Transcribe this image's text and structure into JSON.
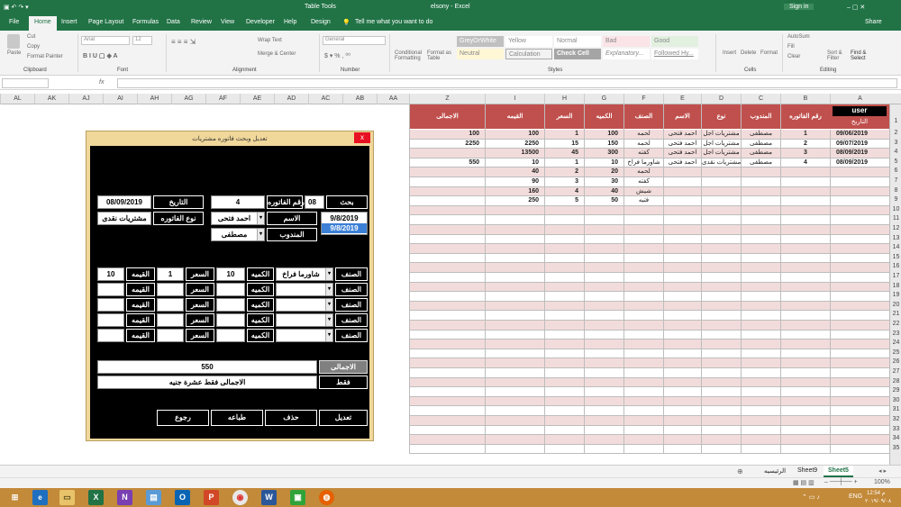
{
  "window": {
    "left_title": "Table Tools",
    "title": "elsony - Excel",
    "sign_in": "Sign in",
    "controls": "–  ▢  ✕"
  },
  "menu": {
    "tabs": [
      "File",
      "Home",
      "Insert",
      "Page Layout",
      "Formulas",
      "Data",
      "Review",
      "View",
      "Developer",
      "Help",
      "Design"
    ],
    "tell": "Tell me what you want to do",
    "share": "Share"
  },
  "ribbon": {
    "paste": "Paste",
    "cut": "Cut",
    "copy": "Copy",
    "format_painter": "Format Painter",
    "clipboard": "Clipboard",
    "font_name": "Arial",
    "font_size": "12",
    "font": "Font",
    "wrap_text": "Wrap Text",
    "merge": "Merge & Center",
    "alignment": "Alignment",
    "number_format": "General",
    "number": "Number",
    "cond_fmt": "Conditional Formatting",
    "format_as_table": "Format as Table",
    "styles": [
      "GreyOrWhite",
      "Yellow",
      "Normal",
      "Bad",
      "Good",
      "Neutral",
      "Calculation",
      "Check Cell",
      "Explanatory...",
      "Followed Hy..."
    ],
    "styles_label": "Styles",
    "insert": "Insert",
    "delete": "Delete",
    "format": "Format",
    "cells": "Cells",
    "autosum": "AutoSum",
    "fill": "Fill",
    "clear": "Clear",
    "sort": "Sort & Filter",
    "find": "Find & Select",
    "editing": "Editing"
  },
  "formula": {
    "name_box": "",
    "fx": "fx",
    "value": ""
  },
  "columns_left": [
    "AL",
    "AK",
    "AJ",
    "AI",
    "AH",
    "AG",
    "AF",
    "AE",
    "AD",
    "AC",
    "AB",
    "AA"
  ],
  "columns_right": [
    "Z",
    "I",
    "H",
    "G",
    "F",
    "E",
    "D",
    "C",
    "B",
    "A"
  ],
  "header_row": {
    "A": "التاريخ",
    "A_top": "user",
    "B": "رقم الفاتوره",
    "C": "المندوب",
    "D": "نوع",
    "E": "الاسم",
    "F": "الصنف",
    "G": "الكميه",
    "H": "السعر",
    "I": "القيمه",
    "Z": "الاجمالى"
  },
  "rows": [
    {
      "n": "2",
      "A": "09/06/2019",
      "B": "1",
      "C": "مصطفى",
      "D": "مشتريات اجل",
      "E": "احمد فتحى",
      "F": "لحمه",
      "G": "100",
      "H": "1",
      "I": "100",
      "Z": "100"
    },
    {
      "n": "3",
      "A": "09/07/2019",
      "B": "2",
      "C": "مصطفى",
      "D": "مشتريات اجل",
      "E": "احمد فتحى",
      "F": "لحمه",
      "G": "150",
      "H": "15",
      "I": "2250",
      "Z": "2250"
    },
    {
      "n": "4",
      "A": "08/09/2019",
      "B": "3",
      "C": "مصطفى",
      "D": "مشتريات اجل",
      "E": "احمد فتحى",
      "F": "كفته",
      "G": "300",
      "H": "45",
      "I": "13500",
      "Z": ""
    },
    {
      "n": "5",
      "A": "08/09/2019",
      "B": "4",
      "C": "مصطفى",
      "D": "مشتريات نقدى",
      "E": "احمد فتحى",
      "F": "شاورما فراخ",
      "G": "10",
      "H": "1",
      "I": "10",
      "Z": "550"
    },
    {
      "n": "6",
      "A": "",
      "B": "",
      "C": "",
      "D": "",
      "E": "",
      "F": "لحمه",
      "G": "20",
      "H": "2",
      "I": "40",
      "Z": ""
    },
    {
      "n": "7",
      "A": "",
      "B": "",
      "C": "",
      "D": "",
      "E": "",
      "F": "كفته",
      "G": "30",
      "H": "3",
      "I": "90",
      "Z": ""
    },
    {
      "n": "8",
      "A": "",
      "B": "",
      "C": "",
      "D": "",
      "E": "",
      "F": "شيش",
      "G": "40",
      "H": "4",
      "I": "160",
      "Z": ""
    },
    {
      "n": "9",
      "A": "",
      "B": "",
      "C": "",
      "D": "",
      "E": "",
      "F": "فتيه",
      "G": "50",
      "H": "5",
      "I": "250",
      "Z": ""
    }
  ],
  "row_numbers": [
    "1",
    "2",
    "3",
    "4",
    "5",
    "6",
    "7",
    "8",
    "9",
    "10",
    "11",
    "12",
    "13",
    "14",
    "15",
    "16",
    "17",
    "18",
    "19",
    "20",
    "21",
    "22",
    "23",
    "24",
    "25",
    "26",
    "27",
    "28",
    "29",
    "30",
    "31",
    "32",
    "33",
    "34",
    "35"
  ],
  "form": {
    "caption": "تعديل وبحث فاتوره مشتريات",
    "close": "x",
    "search_label": "بحث",
    "search_value": "08",
    "invoice_label": "رقم الفاتوره",
    "invoice_value": "4",
    "date_label": "التاريخ",
    "date_value": "08/09/2019",
    "type_label": "نوع الفاتوره",
    "type_value": "مشتريات نقدى",
    "name_label": "الاسم",
    "name_value": "احمد فتحى",
    "rep_label": "المندوب",
    "rep_value": "مصطفى",
    "date_list": [
      "9/8/2019",
      "9/8/2019"
    ],
    "item_label": "الصنف",
    "qty_label": "الكميه",
    "price_label": "السعر",
    "value_label": "القيمه",
    "line1": {
      "item": "شاورما فراخ",
      "qty": "10",
      "price": "1",
      "value": "10"
    },
    "total_label": "الاجمالى",
    "total_value": "550",
    "words_label": "فقط",
    "words_value": "الاجمالى فقط عشرة جنيه",
    "buttons": {
      "edit": "تعديل",
      "delete": "حذف",
      "print": "طباعه",
      "back": "رجوع"
    }
  },
  "sheet_tabs": [
    "الرئيسيه",
    "Sheet9",
    "Sheet5"
  ],
  "status": {
    "zoom": "100%"
  },
  "taskbar": {
    "lang": "ENG",
    "time": "12:54 م",
    "date": "٢٠١٩/٠٩/٠٨"
  }
}
